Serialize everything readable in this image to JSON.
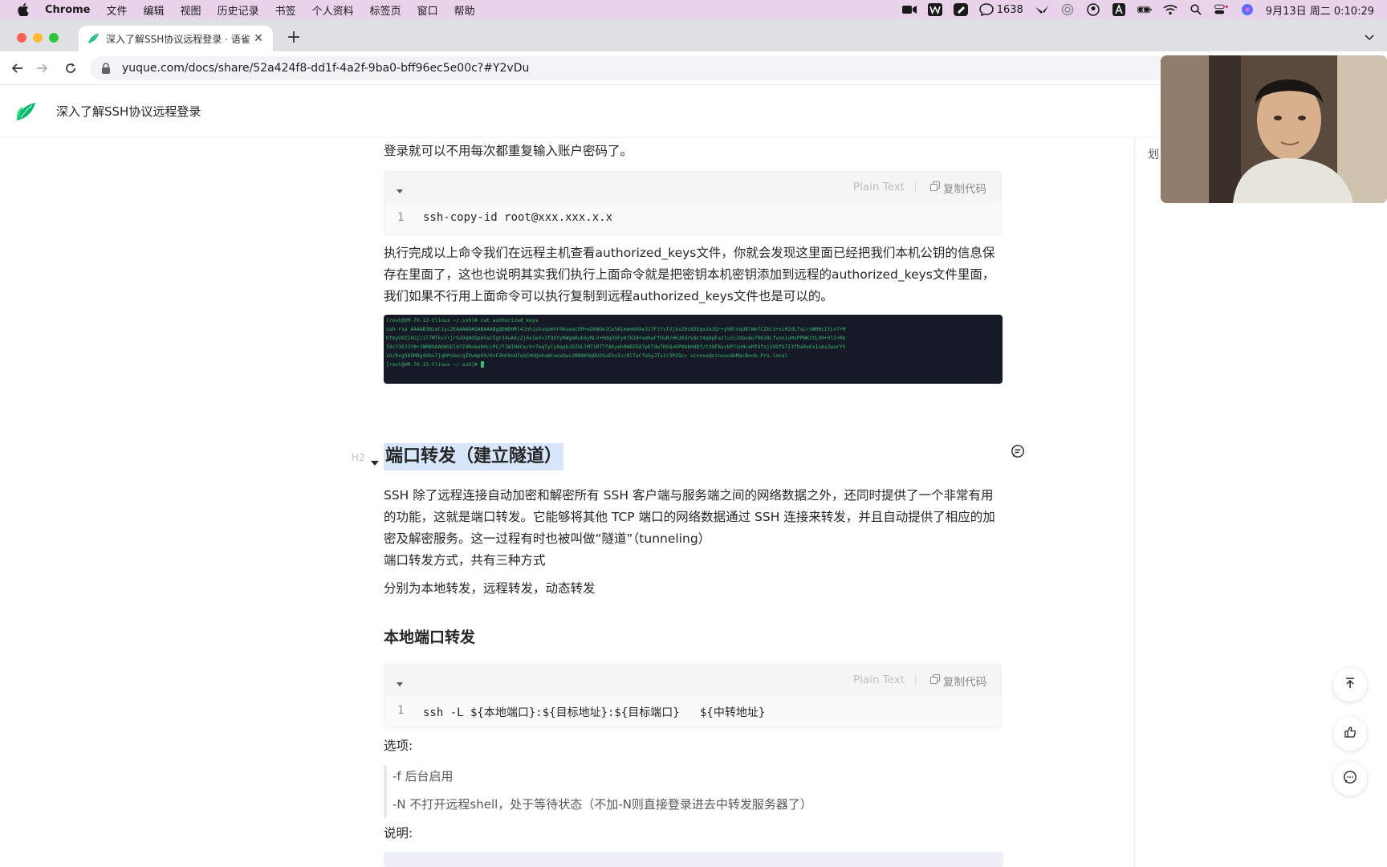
{
  "menubar": {
    "app": "Chrome",
    "items": [
      "文件",
      "编辑",
      "视图",
      "历史记录",
      "书签",
      "个人资料",
      "标签页",
      "窗口",
      "帮助"
    ],
    "notification_count": "1638",
    "datetime": "9月13日 周二 0:10:29"
  },
  "browser": {
    "tab_title": "深入了解SSH协议远程登录 · 语雀",
    "url": "yuque.com/docs/share/52a424f8-dd1f-4a2f-9ba0-bff96ec5e00c?#Y2vDu"
  },
  "doc": {
    "title": "深入了解SSH协议远程登录",
    "right_panel_label": "划",
    "intro_line": "登录就可以不用每次都重复输入账户密码了。",
    "code1": {
      "lang": "Plain Text",
      "copy": "复制代码",
      "line_no": "1",
      "code": "ssh-copy-id root@xxx.xxx.x.x"
    },
    "para1": "执行完成以上命令我们在远程主机查看authorized_keys文件，你就会发现这里面已经把我们本机公钥的信息保存在里面了，这也也说明其实我们执行上面命令就是把密钥本机密钥添加到远程的authorized_keys文件里面，我们如果不行用上面命令可以执行复制到远程authorized_keys文件也是可以的。",
    "terminal": {
      "line1": "[root@VM-70-13-tlinux ~/.ssh]# cat authorized_keys",
      "line2": "ssh-rsa AAAAB3NzaC1yc2EAAAADAQABAAABgQDWDHRl4Jnh1sGunpmVrhKueaiEM+eQ0WOe1Cw5Aimem6A9e3J7FitvIVjkxZHcN2Xqx2a3Qr+y9BlnqUBlWm7CZXc3+xiH2dLfsLrsWRHcItLvT+M",
      "line3": "KfmyV0Z1kGjiil7MTkvJrjrGx9qNdOp6SsC5gt34uAkcZj6xIeVvJfQSYyRWgmRuk6yNLV+Hdq3OFyHlNJQ+smhwFfDuR/H6JKdrLNct4q8pFazlvJcJdavAu79638Lfvnn1uMzPPWK3tL90+VlI+RO",
      "line4": "I9cY3OJJY8+1NM8GAAKWSEl6fZ4RokebHccPC/FJWIN4Ce/O+7eqTyCy8qqbzDZOLlM71RTTfAEyeh0WEEEA7pEfdwTNSQuGPXmbHd8f/tXQF8svkP7snHceMfUfsj3VDfb7I3fDa0xEsIoAsZwarYS",
      "line5": "zO/RxgS65M9g4Xbu7jqRPsGe/qZVwmpO9/0cFZmC8oU7qGCHUQokoWiwoaGws2BRAKOq8U2SnEhoIn/8lTaCfa5yJTs2r3PZQc= xinoso@xinosodeMacBook-Pro.local",
      "line6": "[root@VM-70-13-tlinux ~/.ssh]# "
    },
    "h2": "端口转发（建立隧道）",
    "h2_marker": "H2",
    "para2": "SSH 除了远程连接自动加密和解密所有 SSH 客户端与服务端之间的网络数据之外，还同时提供了一个非常有用的功能，这就是端口转发。它能够将其他 TCP 端口的网络数据通过 SSH 连接来转发，并且自动提供了相应的加密及解密服务。这一过程有时也被叫做“隧道”（tunneling）",
    "para3": "端口转发方式，共有三种方式",
    "para4": "分别为本地转发，远程转发，动态转发",
    "h3": "本地端口转发",
    "code2": {
      "lang": "Plain Text",
      "copy": "复制代码",
      "line_no": "1",
      "code": "ssh -L ${本地端口}:${目标地址}:${目标端口}   ${中转地址}"
    },
    "options_label": "选项:",
    "option1": "-f 后台启用",
    "option2": "-N 不打开远程shell，处于等待状态（不加-N则直接登录进去中转发服务器了）",
    "explain_label": "说明:"
  }
}
